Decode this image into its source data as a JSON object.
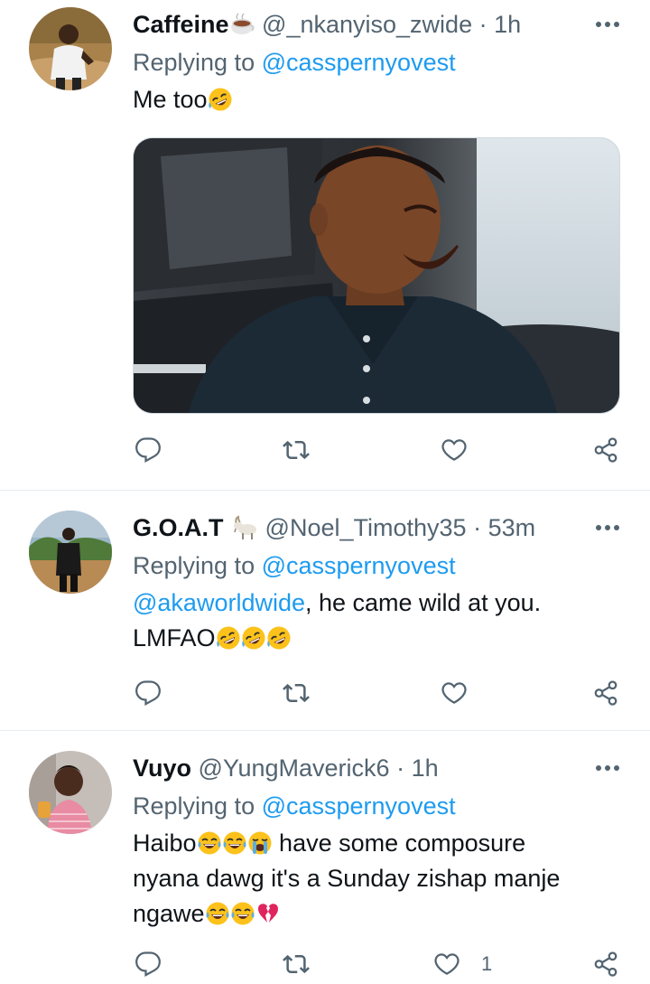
{
  "tweets": [
    {
      "display_name": "Caffeine",
      "name_emoji": "hot-beverage",
      "handle": "@_nkanyiso_zwide",
      "separator": "·",
      "time": "1h",
      "replying_prefix": "Replying to ",
      "replying_to": "@casspernyovest",
      "body": "Me too",
      "body_emojis": [
        "rolling-on-floor-laughing"
      ],
      "has_media": true,
      "media_description_icon": "photo",
      "actions": {
        "reply_count": "",
        "retweet_count": "",
        "like_count": ""
      }
    },
    {
      "display_name": "G.O.A.T",
      "name_emoji": "goat",
      "handle": "@Noel_Timothy35",
      "separator": "·",
      "time": "53m",
      "replying_prefix": "Replying to ",
      "replying_to": "@casspernyovest",
      "body_mention": "@akaworldwide",
      "body_line1": ", he came wild at you.",
      "body_line2": "LMFAO",
      "body_emojis": [
        "rolling-on-floor-laughing",
        "rolling-on-floor-laughing",
        "rolling-on-floor-laughing"
      ],
      "actions": {
        "reply_count": "",
        "retweet_count": "",
        "like_count": ""
      }
    },
    {
      "display_name": "Vuyo",
      "handle": "@YungMaverick6",
      "separator": "·",
      "time": "1h",
      "replying_prefix": "Replying to ",
      "replying_to": "@casspernyovest",
      "body_start": "Haibo",
      "body_after_emojis": " have some composure",
      "body_line2": "nyana dawg it's a Sunday zishap manje",
      "body_line3": "ngawe",
      "body_emojis_1": [
        "face-with-tears-of-joy",
        "face-with-tears-of-joy",
        "loudly-crying-face"
      ],
      "body_emojis_3": [
        "face-with-tears-of-joy",
        "face-with-tears-of-joy",
        "broken-heart"
      ],
      "actions": {
        "reply_count": "",
        "retweet_count": "",
        "like_count": "1"
      }
    }
  ],
  "colors": {
    "text": "#0f1419",
    "secondary": "#536471",
    "link": "#1d9bf0",
    "divider": "#e6ecf0"
  }
}
